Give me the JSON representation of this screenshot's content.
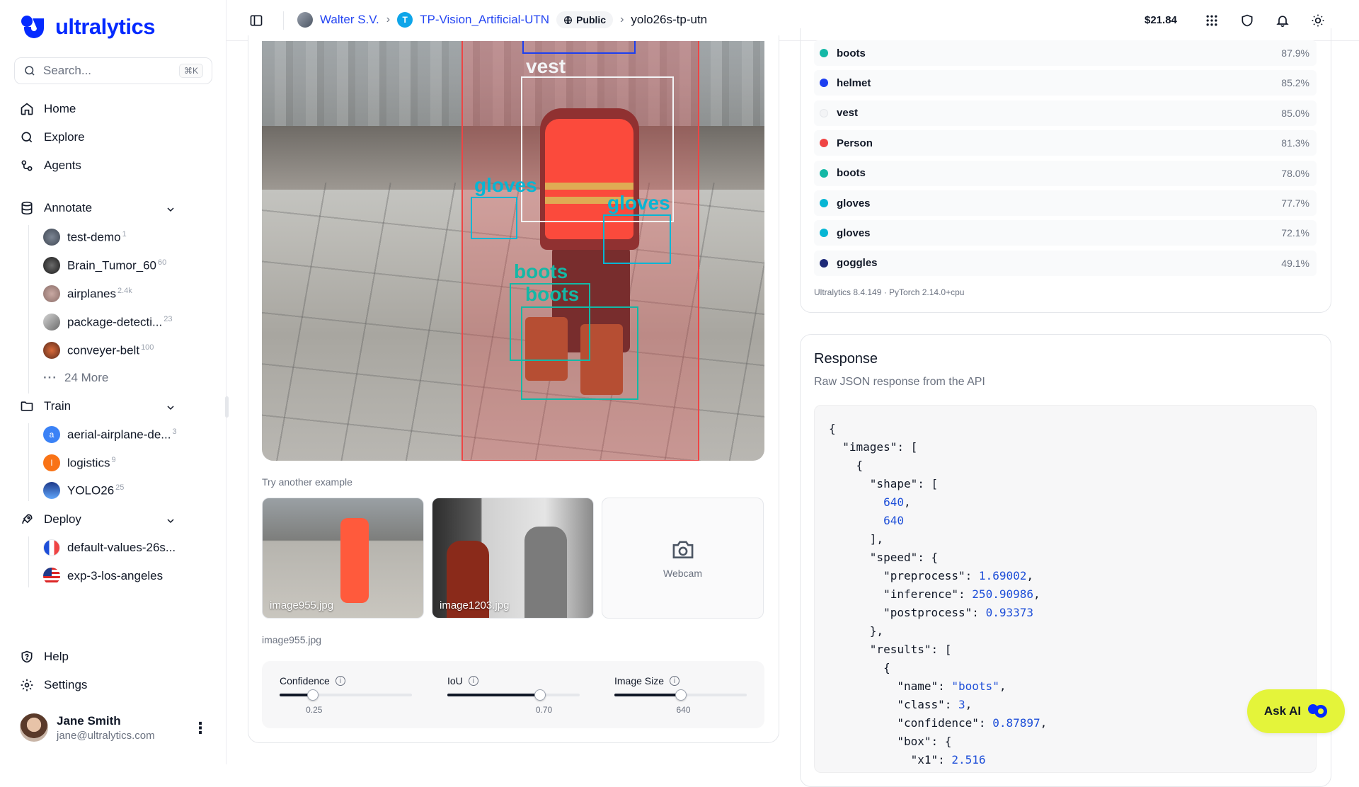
{
  "brand": {
    "name": "ultralytics"
  },
  "search": {
    "placeholder": "Search...",
    "shortcut": "⌘K"
  },
  "nav": {
    "home": "Home",
    "explore": "Explore",
    "agents": "Agents",
    "annotate": "Annotate",
    "train": "Train",
    "deploy": "Deploy",
    "help": "Help",
    "settings": "Settings"
  },
  "annotate_items": [
    {
      "label": "test-demo",
      "count": "1"
    },
    {
      "label": "Brain_Tumor_60",
      "count": "60"
    },
    {
      "label": "airplanes",
      "count": "2.4k"
    },
    {
      "label": "package-detecti...",
      "count": "23"
    },
    {
      "label": "conveyer-belt",
      "count": "100"
    }
  ],
  "annotate_more": "24 More",
  "train_items": [
    {
      "label": "aerial-airplane-de...",
      "count": "3",
      "letter": "a"
    },
    {
      "label": "logistics",
      "count": "9",
      "letter": "l"
    },
    {
      "label": "YOLO26",
      "count": "25",
      "letter": ""
    }
  ],
  "deploy_items": [
    {
      "label": "default-values-26s..."
    },
    {
      "label": "exp-3-los-angeles"
    }
  ],
  "user": {
    "name": "Jane Smith",
    "email": "jane@ultralytics.com"
  },
  "breadcrumb": {
    "owner": "Walter S.V.",
    "project_letter": "T",
    "project": "TP-Vision_Artificial-UTN",
    "visibility": "Public",
    "model": "yolo26s-tp-utn"
  },
  "credits": "$21.84",
  "image_labels": {
    "vest": "vest",
    "gloves1": "gloves",
    "gloves2": "gloves",
    "boots1": "boots",
    "boots2": "boots"
  },
  "examples": {
    "title": "Try another example",
    "items": [
      "image955.jpg",
      "image1203.jpg"
    ],
    "webcam": "Webcam",
    "selected": "image955.jpg"
  },
  "params": [
    {
      "label": "Confidence",
      "value": "0.25",
      "fraction": 0.25
    },
    {
      "label": "IoU",
      "value": "0.70",
      "fraction": 0.7
    },
    {
      "label": "Image Size",
      "value": "640",
      "fraction": 0.5
    }
  ],
  "detections": [
    {
      "name": "boots",
      "confidence": "87.9%",
      "color": "#14b8a6"
    },
    {
      "name": "helmet",
      "confidence": "85.2%",
      "color": "#1d3ff0"
    },
    {
      "name": "vest",
      "confidence": "85.0%",
      "color": "#f3f4f6"
    },
    {
      "name": "Person",
      "confidence": "81.3%",
      "color": "#ef4444"
    },
    {
      "name": "boots",
      "confidence": "78.0%",
      "color": "#14b8a6"
    },
    {
      "name": "gloves",
      "confidence": "77.7%",
      "color": "#06b6d4"
    },
    {
      "name": "gloves",
      "confidence": "72.1%",
      "color": "#06b6d4"
    },
    {
      "name": "goggles",
      "confidence": "49.1%",
      "color": "#1e2a78"
    }
  ],
  "version": "Ultralytics 8.4.149 · PyTorch 2.14.0+cpu",
  "response": {
    "title": "Response",
    "subtitle": "Raw JSON response from the API"
  },
  "ask_ai": "Ask AI"
}
